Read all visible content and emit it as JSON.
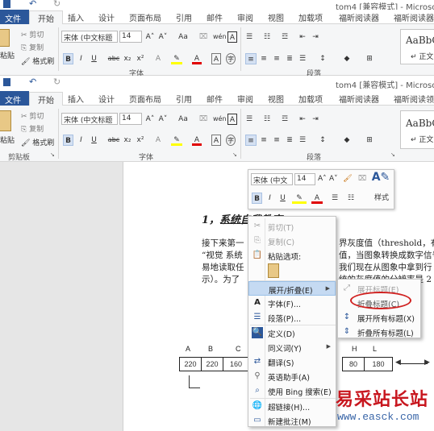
{
  "window": {
    "title": "tom4 [兼容模式] - Microsoft W"
  },
  "tabs": [
    "文件",
    "开始",
    "插入",
    "设计",
    "页面布局",
    "引用",
    "邮件",
    "审阅",
    "视图",
    "加载项",
    "福昕阅读器",
    "福昕阅读领"
  ],
  "tabs_top_last": "福昕阅读器",
  "clipboard": {
    "paste": "粘贴",
    "cut": "剪切",
    "copy": "复制",
    "format_painter": "格式刷",
    "group": "剪贴板"
  },
  "font": {
    "name": "宋体 (中文标题",
    "size": "14",
    "group": "字体",
    "aa": "Aa",
    "wen": "wén"
  },
  "paragraph": {
    "group": "段落"
  },
  "styles": {
    "preview": "AaBbC",
    "name": "正文"
  },
  "mini_toolbar": {
    "font": "宋体 (中文",
    "size": "14",
    "styles": "样式"
  },
  "document": {
    "heading": "1，系统自我教育",
    "lines": [
      "接下来第一",
      "“视觉 系统",
      "易地读取任",
      "示）。为了"
    ],
    "lines_right": [
      "界灰度值（threshold，有",
      "值，当图象转换成数字信号",
      "我们现在从图象中拿到行",
      "统的灰度值的分辨率是 2"
    ],
    "col_letters": [
      "A",
      "B",
      "C",
      "H",
      "L"
    ],
    "cells": [
      "220",
      "220",
      "160",
      "80",
      "180"
    ]
  },
  "context_menu": {
    "items": [
      {
        "icon": "scissors-icon",
        "label": "剪切(T)",
        "enabled": false
      },
      {
        "icon": "copy-icon",
        "label": "复制(C)",
        "enabled": false
      },
      {
        "icon": "clipboard-icon",
        "label": "粘贴选项:",
        "enabled": true
      },
      {
        "icon": "",
        "label": "",
        "enabled": true
      },
      {
        "icon": "",
        "label": "展开/折叠(E)",
        "enabled": true,
        "submenu": true,
        "highlighted": true
      },
      {
        "icon": "font-icon",
        "label": "字体(F)...",
        "enabled": true
      },
      {
        "icon": "paragraph-icon",
        "label": "段落(P)...",
        "enabled": true
      },
      {
        "icon": "define-icon",
        "label": "定义(D)",
        "enabled": true
      },
      {
        "icon": "",
        "label": "同义词(Y)",
        "enabled": true,
        "submenu": true
      },
      {
        "icon": "translate-icon",
        "label": "翻译(S)",
        "enabled": true
      },
      {
        "icon": "english-assistant-icon",
        "label": "英语助手(A)",
        "enabled": true
      },
      {
        "icon": "bing-search-icon",
        "label": "使用 Bing 搜索(E)",
        "enabled": true
      },
      {
        "icon": "hyperlink-icon",
        "label": "超链接(H)...",
        "enabled": true
      },
      {
        "icon": "new-comment-icon",
        "label": "新建批注(M)",
        "enabled": true
      }
    ]
  },
  "submenu": {
    "items": [
      {
        "label": "展开标题(E)",
        "enabled": false
      },
      {
        "label": "折叠标题(C)",
        "enabled": true,
        "circled": true
      },
      {
        "label": "展开所有标题(X)",
        "enabled": true
      },
      {
        "label": "折叠所有标题(L)",
        "enabled": true
      }
    ]
  },
  "watermark": {
    "brand": "易采站长站",
    "url": "www.easck.com"
  },
  "colors": {
    "accent": "#2b579a",
    "highlight_circle": "#d0201f",
    "watermark": "#c8171f"
  }
}
